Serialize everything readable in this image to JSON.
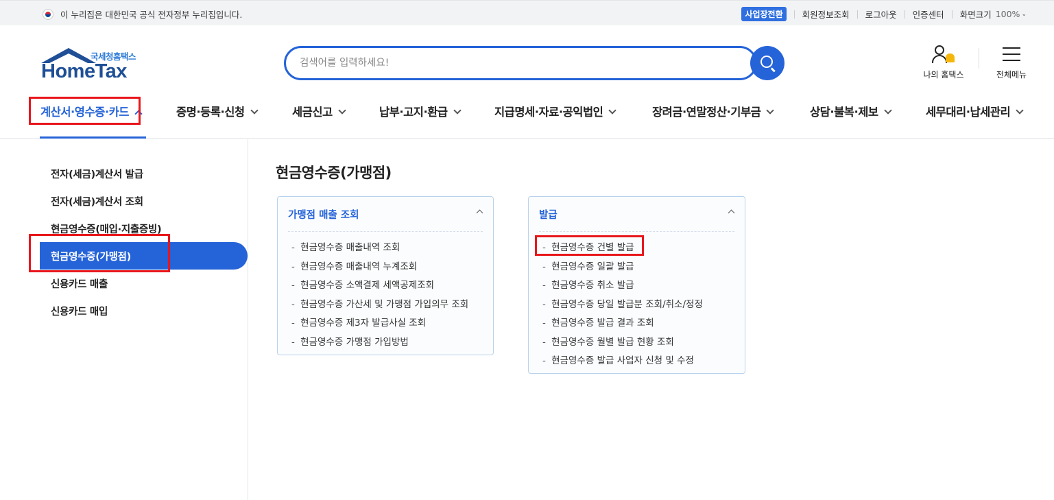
{
  "govbar": {
    "notice": "이 누리집은 대한민국 공식 전자정부 누리집입니다.",
    "business_switch": "사업장전환",
    "member_info": "회원정보조회",
    "logout": "로그아웃",
    "cert_center": "인증센터",
    "screen_size": "화면크기",
    "zoom": "100%"
  },
  "header": {
    "logo_sub": "국세청홈택스",
    "logo_main": "HomeTax",
    "search_placeholder": "검색어를 입력하세요!",
    "my_hometax": "나의 홈택스",
    "all_menu": "전체메뉴"
  },
  "nav": {
    "items": [
      {
        "label": "계산서·영수증·카드"
      },
      {
        "label": "증명·등록·신청"
      },
      {
        "label": "세금신고"
      },
      {
        "label": "납부·고지·환급"
      },
      {
        "label": "지급명세·자료·공익법인"
      },
      {
        "label": "장려금·연말정산·기부금"
      },
      {
        "label": "상담·불복·제보"
      },
      {
        "label": "세무대리·납세관리"
      }
    ]
  },
  "sidebar": {
    "items": [
      {
        "label": "전자(세금)계산서 발급"
      },
      {
        "label": "전자(세금)계산서 조회"
      },
      {
        "label": "현금영수증(매입·지출증빙)"
      },
      {
        "label": "현금영수증(가맹점)"
      },
      {
        "label": "신용카드 매출"
      },
      {
        "label": "신용카드 매입"
      }
    ]
  },
  "main": {
    "title": "현금영수증(가맹점)",
    "cards": [
      {
        "title": "가맹점 매출 조회",
        "links": [
          "현금영수증 매출내역 조회",
          "현금영수증 매출내역 누계조회",
          "현금영수증 소액결제 세액공제조회",
          "현금영수증 가산세 및 가맹점 가입의무 조회",
          "현금영수증 제3자 발급사실 조회",
          "현금영수증 가맹점 가입방법"
        ]
      },
      {
        "title": "발급",
        "links": [
          "현금영수증 건별 발급",
          "현금영수증 일괄 발급",
          "현금영수증 취소 발급",
          "현금영수증 당일 발급분 조회/취소/정정",
          "현금영수증 발급 결과 조회",
          "현금영수증 월별 발급 현황 조회",
          "현금영수증 발급 사업자 신청 및 수정"
        ]
      }
    ]
  },
  "colors": {
    "accent": "#2563d8",
    "highlight_box": "#e8161b",
    "logo": "#1f4f96"
  }
}
